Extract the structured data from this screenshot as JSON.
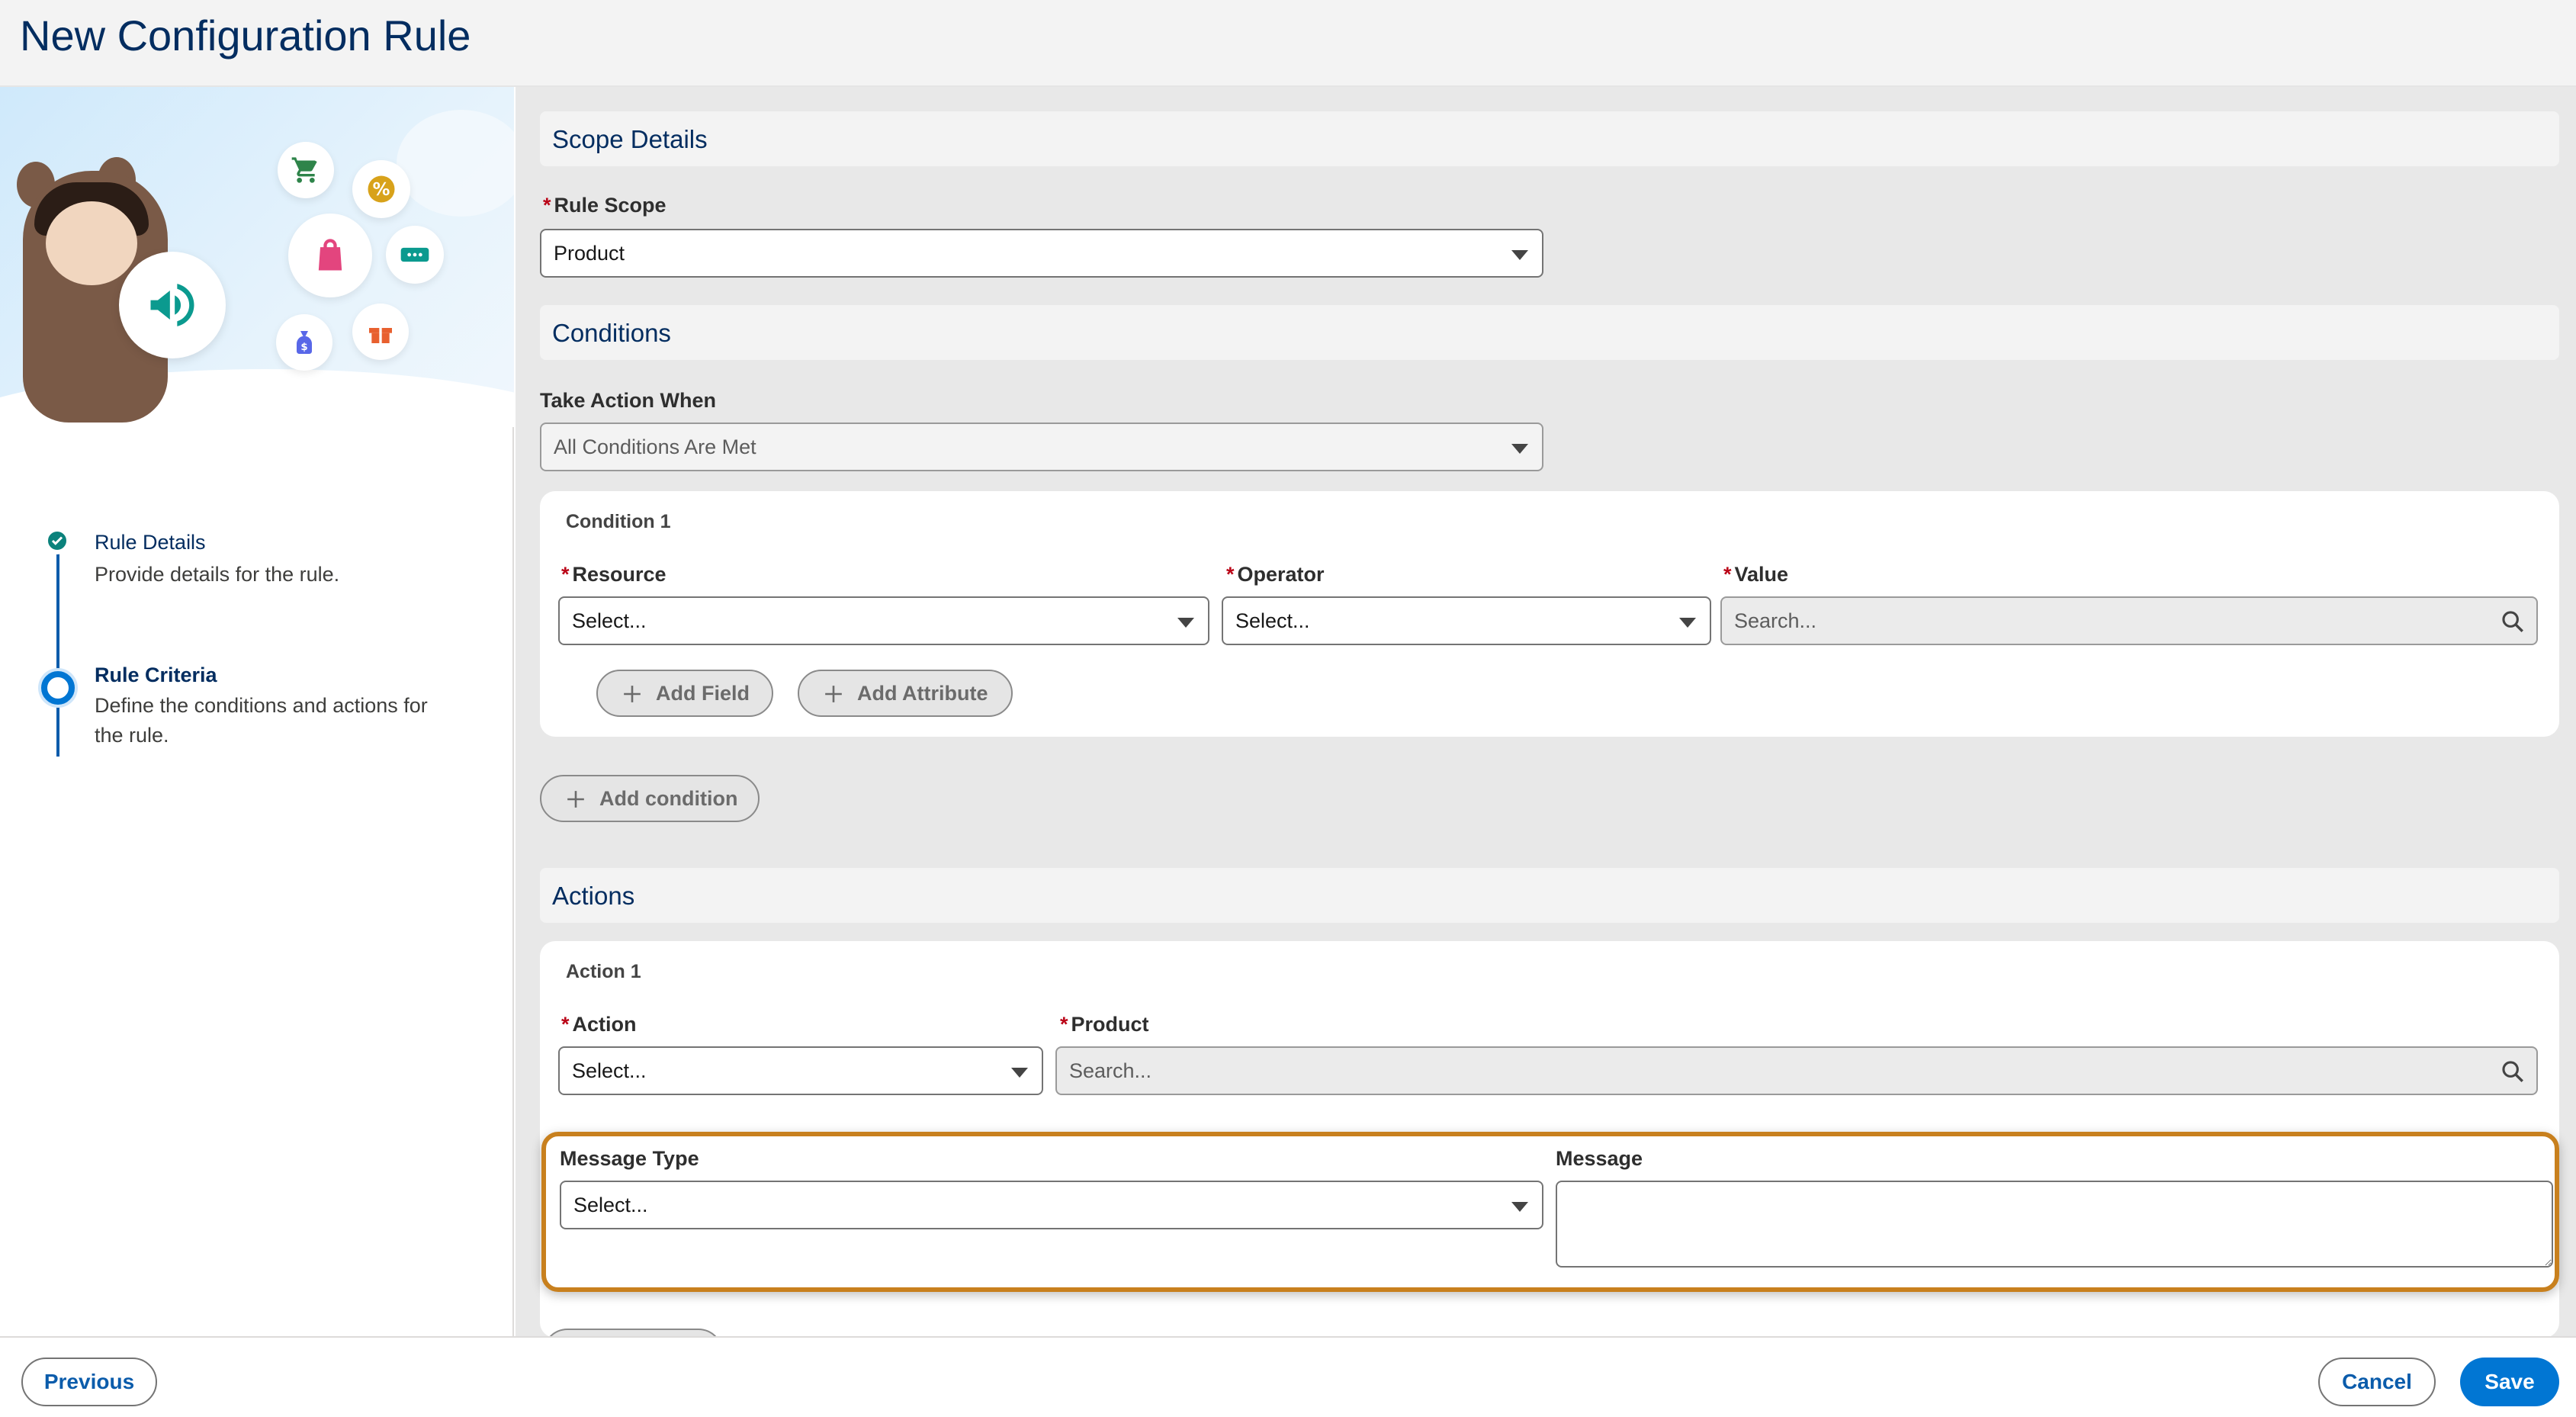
{
  "header": {
    "title": "New Configuration Rule"
  },
  "steps": [
    {
      "title": "Rule Details",
      "description": "Provide details for the rule.",
      "status": "complete"
    },
    {
      "title": "Rule Criteria",
      "description": "Define the conditions and actions for the rule.",
      "status": "current"
    }
  ],
  "scope": {
    "heading": "Scope Details",
    "rule_scope_label": "Rule Scope",
    "rule_scope_value": "Product"
  },
  "conditions": {
    "heading": "Conditions",
    "take_action_label": "Take Action When",
    "take_action_value": "All Conditions Are Met",
    "condition_card": {
      "title": "Condition 1",
      "resource_label": "Resource",
      "resource_value": "Select...",
      "operator_label": "Operator",
      "operator_value": "Select...",
      "value_label": "Value",
      "value_placeholder": "Search...",
      "add_field_label": "Add Field",
      "add_attribute_label": "Add Attribute"
    },
    "add_condition_label": "Add condition"
  },
  "actions": {
    "heading": "Actions",
    "action_card": {
      "title": "Action 1",
      "action_label": "Action",
      "action_value": "Select...",
      "product_label": "Product",
      "product_placeholder": "Search...",
      "message_type_label": "Message Type",
      "message_type_value": "Select...",
      "message_label": "Message",
      "message_value": ""
    }
  },
  "footer": {
    "previous_label": "Previous",
    "cancel_label": "Cancel",
    "save_label": "Save"
  },
  "colors": {
    "brand": "#0176d3",
    "title_navy": "#032d60",
    "required": "#ba0517",
    "highlight": "#c8801e",
    "step_complete": "#0b827c"
  },
  "icons": [
    "cart-icon",
    "percent-icon",
    "shopping-bag-icon",
    "ticket-icon",
    "money-bag-icon",
    "gift-icon",
    "megaphone-icon",
    "check-icon",
    "search-icon",
    "plus-icon",
    "chevron-down-icon"
  ]
}
